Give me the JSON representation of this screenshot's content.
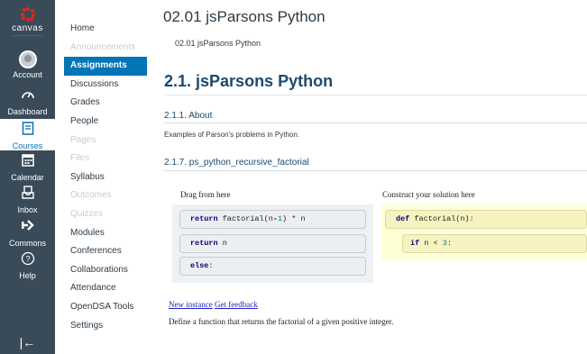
{
  "global_nav": {
    "logo": "canvas",
    "account": "Account",
    "dashboard": "Dashboard",
    "courses": "Courses",
    "calendar": "Calendar",
    "inbox": "Inbox",
    "commons": "Commons",
    "help": "Help",
    "collapse_glyph": "|←"
  },
  "course_nav": {
    "items": [
      {
        "label": "Home"
      },
      {
        "label": "Announcements"
      },
      {
        "label": "Assignments"
      },
      {
        "label": "Discussions"
      },
      {
        "label": "Grades"
      },
      {
        "label": "People"
      },
      {
        "label": "Pages"
      },
      {
        "label": "Files"
      },
      {
        "label": "Syllabus"
      },
      {
        "label": "Outcomes"
      },
      {
        "label": "Quizzes"
      },
      {
        "label": "Modules"
      },
      {
        "label": "Conferences"
      },
      {
        "label": "Collaborations"
      },
      {
        "label": "Attendance"
      },
      {
        "label": "OpenDSA Tools"
      },
      {
        "label": "Settings"
      }
    ]
  },
  "content": {
    "page_title": "02.01 jsParsons Python",
    "sub_title": "02.01 jsParsons Python",
    "h1": "2.1. jsParsons Python",
    "about_heading": "2.1.1. About",
    "about_text": "Examples of Parson's problems in Python.",
    "exercise_heading": "2.1.7. ps_python_recursive_factorial",
    "drag_label": "Drag from here",
    "solution_label": "Construct your solution here",
    "source_lines": [
      {
        "keyword": "return",
        "rest_a": " factorial(n",
        "op": "-",
        "num": "1",
        "rest_b": ") * n"
      },
      {
        "keyword": "return",
        "rest": " n"
      },
      {
        "keyword": "else",
        "rest": ":"
      }
    ],
    "solution_lines": [
      {
        "keyword": "def",
        "rest": " factorial(n):"
      },
      {
        "keyword": "if",
        "rest_a": " n < ",
        "num": "3",
        "rest_b": ":"
      }
    ],
    "new_instance": "New instance",
    "get_feedback": "Get feedback",
    "description": "Define a function that returns the factorial of a given positive integer."
  }
}
